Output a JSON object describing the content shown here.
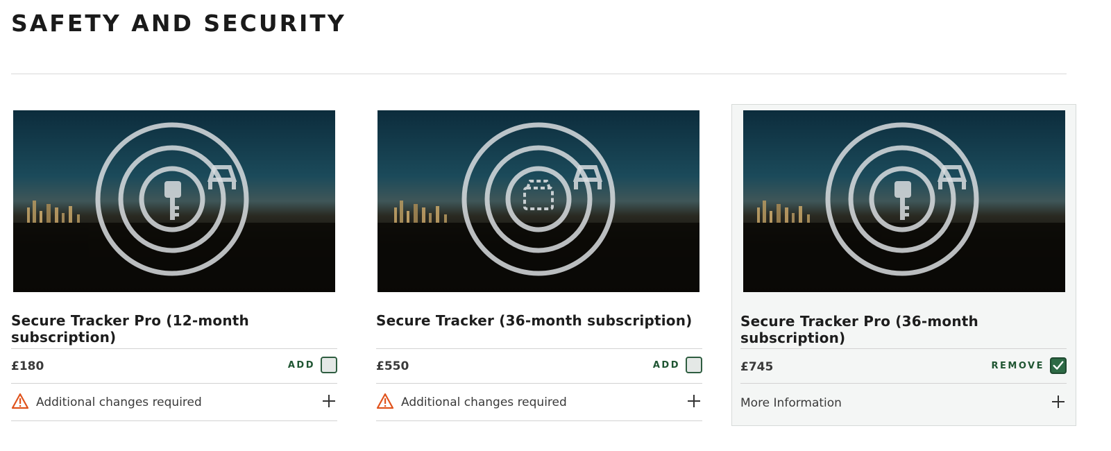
{
  "section": {
    "title": "SAFETY AND SECURITY"
  },
  "cards": [
    {
      "title": "Secure Tracker Pro (12-month subscription)",
      "price": "£180",
      "action_label": "ADD",
      "checked": false,
      "info_text": "Additional changes required",
      "info_icon": "warning-icon",
      "center_icon": "key-icon"
    },
    {
      "title": "Secure Tracker (36-month subscription)",
      "price": "£550",
      "action_label": "ADD",
      "checked": false,
      "info_text": "Additional changes required",
      "info_icon": "warning-icon",
      "center_icon": "car-outline-icon"
    },
    {
      "title": "Secure Tracker Pro (36-month subscription)",
      "price": "£745",
      "action_label": "REMOVE",
      "checked": true,
      "info_text": "More Information",
      "info_icon": "none",
      "center_icon": "key-icon"
    }
  ],
  "colors": {
    "accent_green": "#1f5532",
    "warning_orange": "#e0531c",
    "selected_bg": "#f4f6f5"
  }
}
